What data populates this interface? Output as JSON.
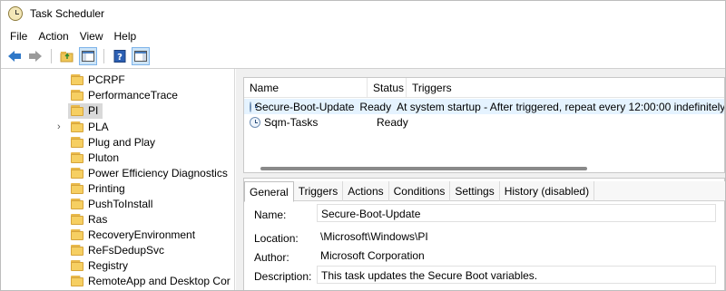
{
  "window": {
    "title": "Task Scheduler"
  },
  "menu": [
    "File",
    "Action",
    "View",
    "Help"
  ],
  "toolbar": {
    "buttons": [
      "back-arrow-icon",
      "forward-arrow-icon",
      "folder-up-icon",
      "show-hide-console-tree-icon",
      "help-icon",
      "show-hide-action-pane-icon"
    ]
  },
  "tree": {
    "items": [
      {
        "label": "PCRPF"
      },
      {
        "label": "PerformanceTrace"
      },
      {
        "label": "PI",
        "selected": true
      },
      {
        "label": "PLA",
        "expandable": true
      },
      {
        "label": "Plug and Play"
      },
      {
        "label": "Pluton"
      },
      {
        "label": "Power Efficiency Diagnostics"
      },
      {
        "label": "Printing"
      },
      {
        "label": "PushToInstall"
      },
      {
        "label": "Ras"
      },
      {
        "label": "RecoveryEnvironment"
      },
      {
        "label": "ReFsDedupSvc"
      },
      {
        "label": "Registry"
      },
      {
        "label": "RemoteApp and Desktop Cor"
      }
    ]
  },
  "task_list": {
    "columns": [
      "Name",
      "Status",
      "Triggers"
    ],
    "rows": [
      {
        "name": "Secure-Boot-Update",
        "status": "Ready",
        "triggers": "At system startup - After triggered, repeat every 12:00:00 indefinitely."
      },
      {
        "name": "Sqm-Tasks",
        "status": "Ready",
        "triggers": ""
      }
    ]
  },
  "details": {
    "tabs": [
      "General",
      "Triggers",
      "Actions",
      "Conditions",
      "Settings",
      "History (disabled)"
    ],
    "active_tab": "General",
    "fields": {
      "name_label": "Name:",
      "name_value": "Secure-Boot-Update",
      "location_label": "Location:",
      "location_value": "\\Microsoft\\Windows\\PI",
      "author_label": "Author:",
      "author_value": "Microsoft Corporation",
      "description_label": "Description:",
      "description_value": "This task updates the Secure Boot variables."
    }
  }
}
